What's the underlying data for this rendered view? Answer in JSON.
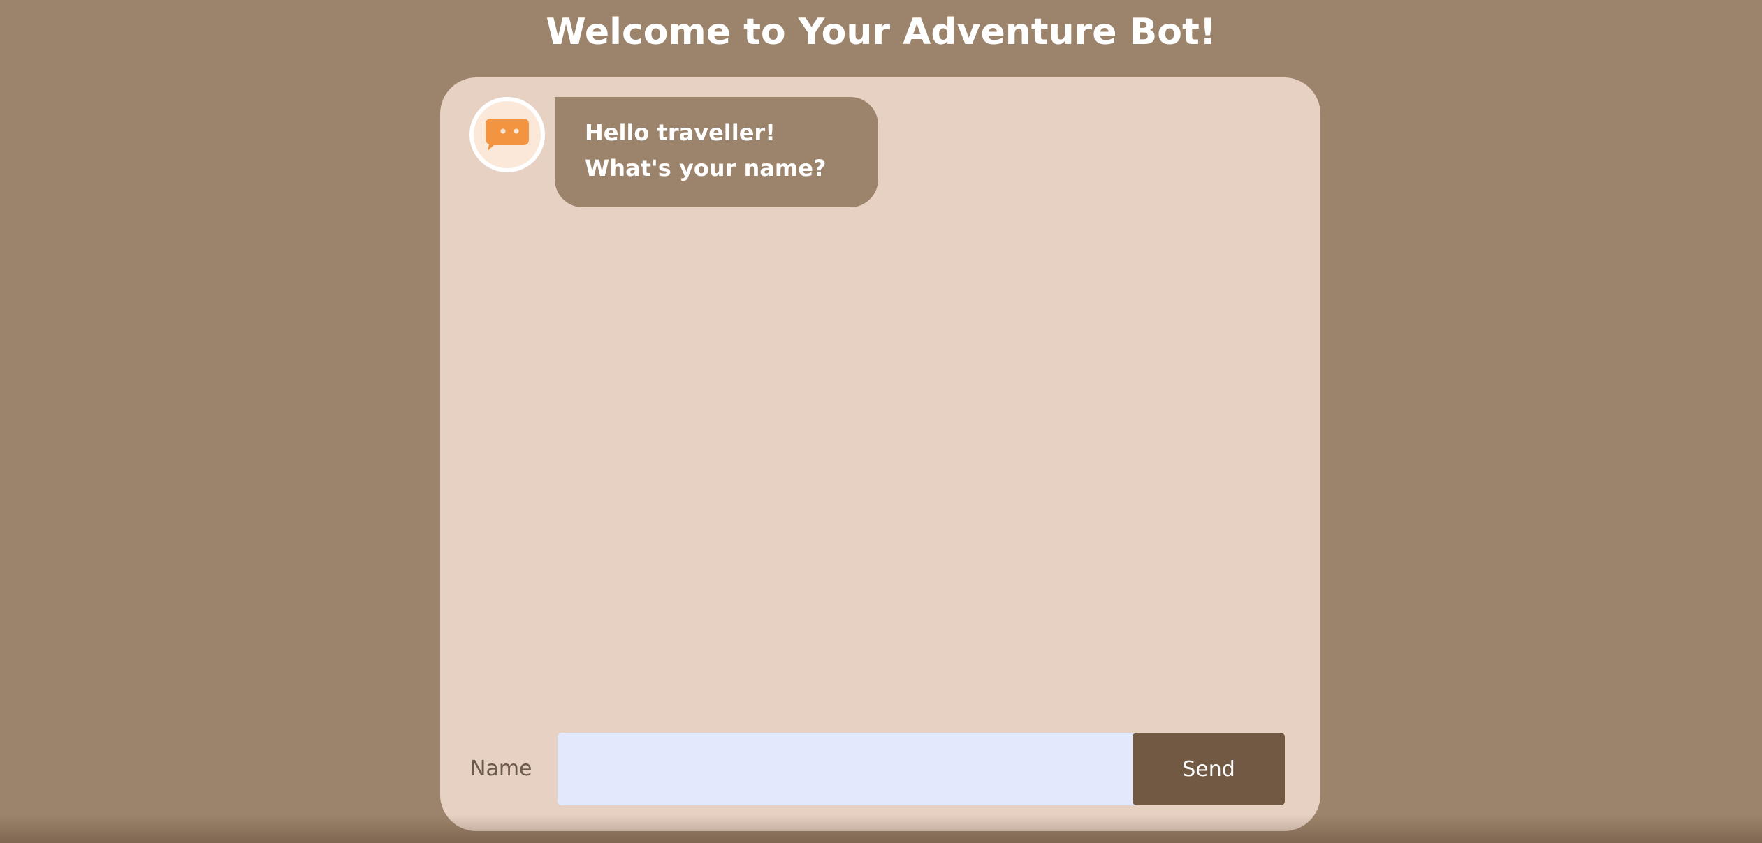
{
  "page": {
    "title": "Welcome to Your Adventure Bot!"
  },
  "chat": {
    "messages": [
      {
        "sender": "bot",
        "avatar_icon": "chat-bubble-icon",
        "text": "Hello traveller! What's your name?"
      }
    ]
  },
  "form": {
    "label": "Name",
    "input_value": "",
    "send_label": "Send"
  },
  "colors": {
    "background": "#9c836b",
    "card": "#e7d1c3",
    "bubble": "#9c836b",
    "avatar_icon": "#f39441",
    "input": "#e3e9fd",
    "send_button": "#725943"
  }
}
